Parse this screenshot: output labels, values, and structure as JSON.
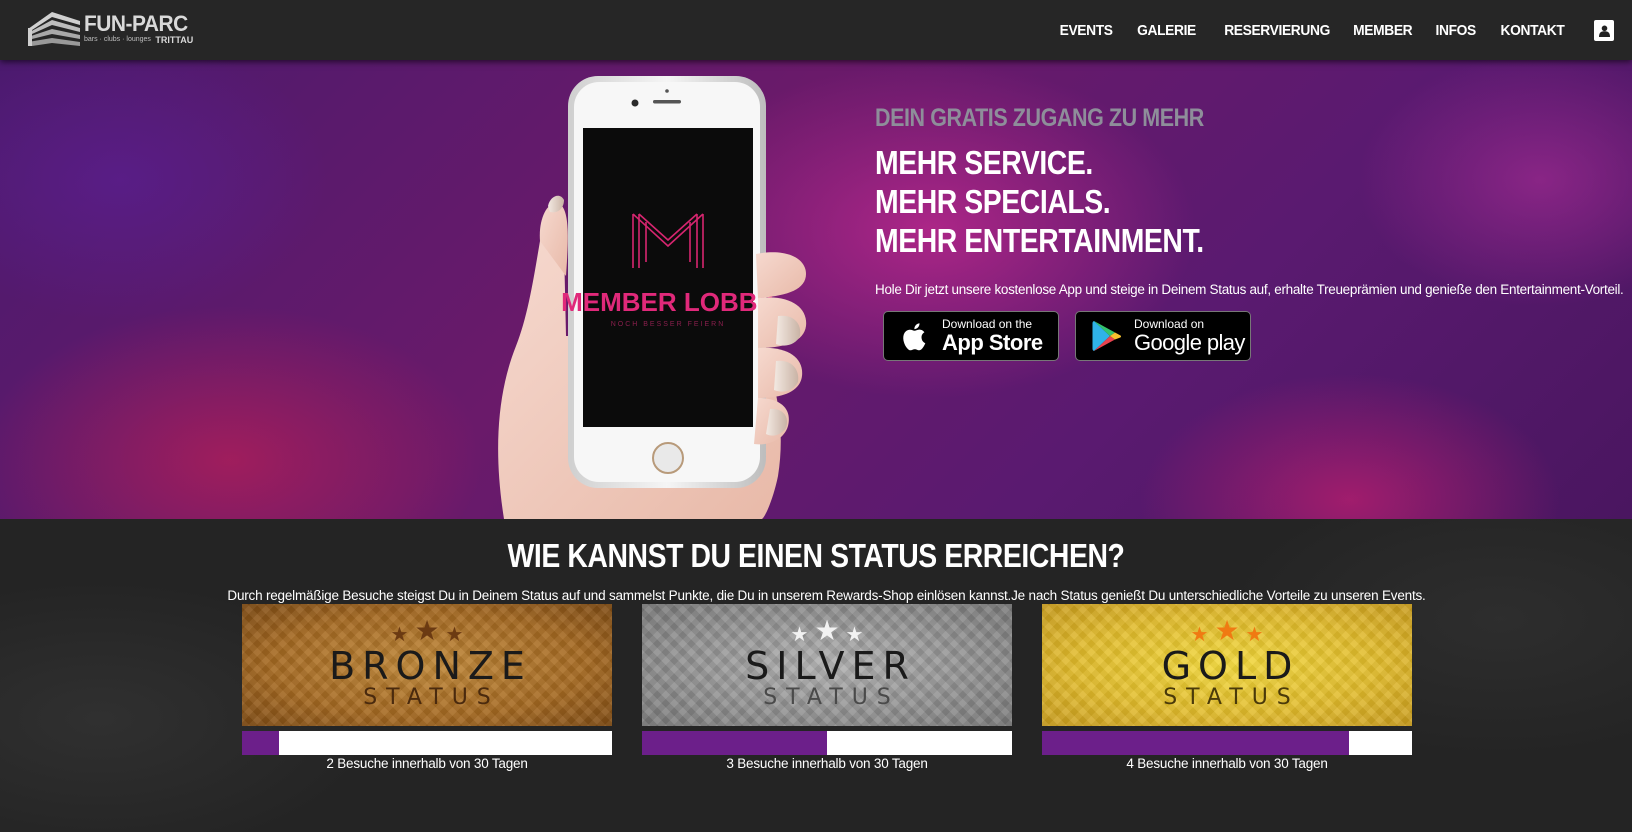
{
  "header": {
    "logo": {
      "title": "FUN-PARC",
      "tagline": "bars · clubs · lounges",
      "location": "TRITTAU"
    },
    "nav": [
      "EVENTS",
      "GALERIE",
      "RESERVIERUNG",
      "MEMBER",
      "INFOS",
      "KONTAKT"
    ],
    "user_icon": "user-icon"
  },
  "hero": {
    "phone_app_title": "MEMBER LOBBY",
    "phone_app_subtitle": "NOCH BESSER FEIERN",
    "kicker": "DEIN GRATIS ZUGANG ZU MEHR",
    "headline": [
      "MEHR SERVICE.",
      "MEHR SPECIALS.",
      "MEHR ENTERTAINMENT."
    ],
    "description": "Hole Dir jetzt unsere kostenlose App und steige in Deinem Status auf, erhalte Treueprämien und genieße den Entertainment-Vorteil.",
    "app_store": {
      "small": "Download on the",
      "big": "App Store",
      "icon": "apple-icon"
    },
    "google_play": {
      "small": "Download on",
      "big": "Google play",
      "icon": "google-play-icon"
    }
  },
  "status_section": {
    "title": "WIE KANNST DU EINEN STATUS ERREICHEN?",
    "description": "Durch regelmäßige Besuche steigst Du in Deinem Status auf und sammelst Punkte, die Du in unserem Rewards-Shop einlösen kannst.Je nach Status genießt Du unterschiedliche Vorteile zu unseren Events.",
    "tiers": [
      {
        "name": "BRONZE",
        "subtitle": "STATUS",
        "progress": 0.1,
        "label": "2 Besuche innerhalb von 30 Tagen",
        "star_color": "#6b3a12",
        "subtitle_color": "#4a2a0e"
      },
      {
        "name": "SILVER",
        "subtitle": "STATUS",
        "progress": 0.5,
        "label": "3 Besuche innerhalb von 30 Tagen",
        "star_color": "#f2f2f2",
        "subtitle_color": "#4a4a4a"
      },
      {
        "name": "GOLD",
        "subtitle": "STATUS",
        "progress": 0.83,
        "label": "4 Besuche innerhalb von 30 Tagen",
        "star_color": "#f07a12",
        "subtitle_color": "#4a3a0a"
      }
    ],
    "progress_color": "#6c1f8a"
  }
}
